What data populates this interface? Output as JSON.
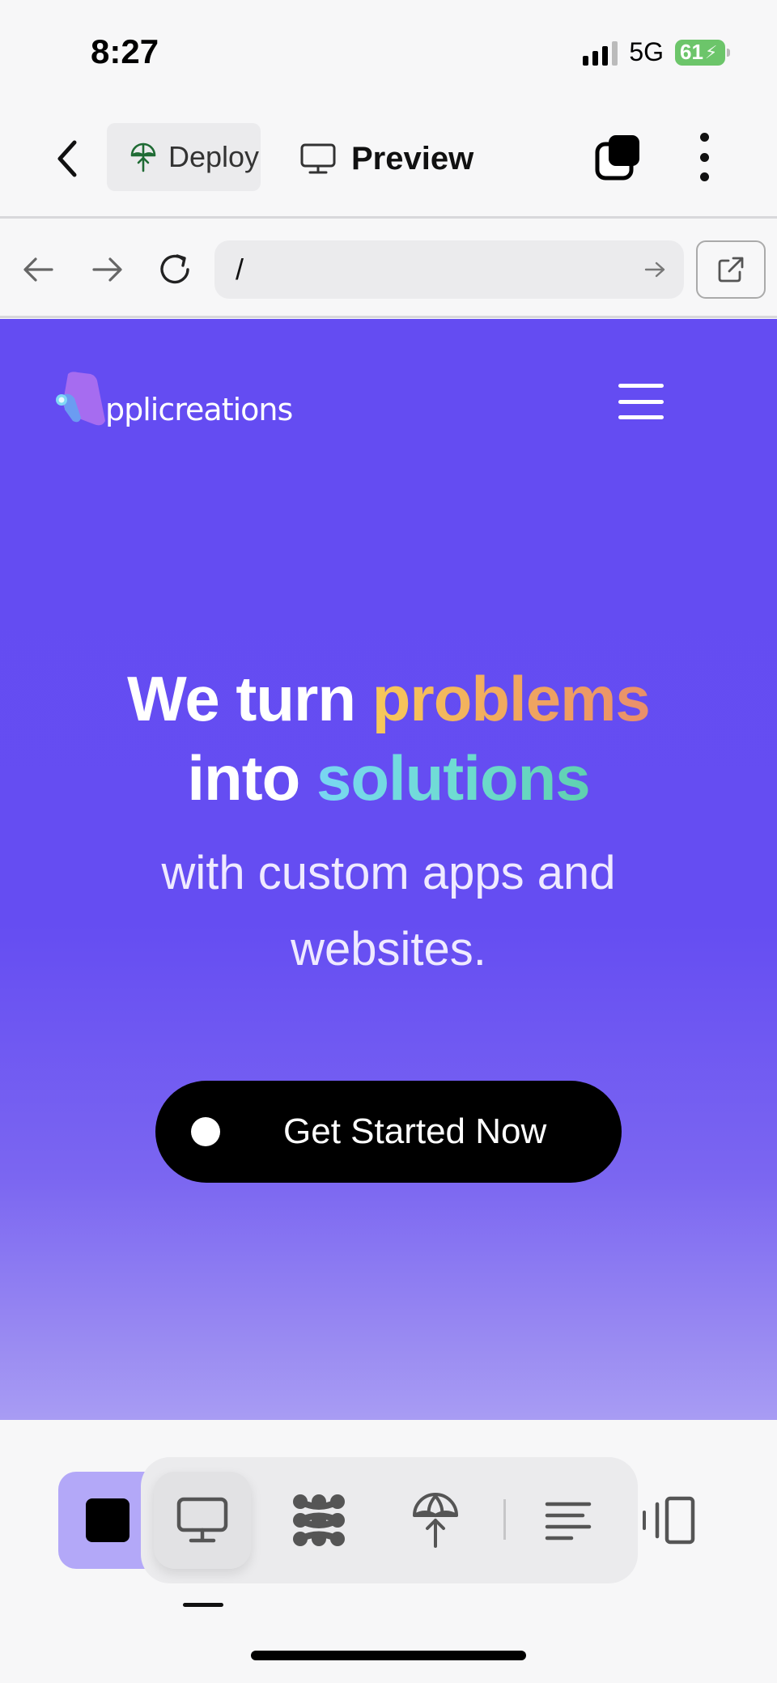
{
  "status_bar": {
    "time": "8:27",
    "network": "5G",
    "battery": "61",
    "battery_color": "#6cc56a"
  },
  "top_bar": {
    "deploy_label": "Deploy",
    "preview_label": "Preview",
    "icons": [
      "chevron-left-icon",
      "deploy-icon",
      "monitor-icon",
      "tabs-icon",
      "more-vertical-icon"
    ]
  },
  "address_bar": {
    "url": "/",
    "icons": [
      "arrow-left-icon",
      "arrow-right-icon",
      "reload-icon",
      "go-arrow-icon",
      "external-link-icon"
    ]
  },
  "site": {
    "logo_text": "pplicreations",
    "hero_line1_prefix": "We turn ",
    "hero_line1_highlight": "problems",
    "hero_line2_prefix": "into ",
    "hero_line2_highlight": "solutions",
    "hero_subtitle": "with custom apps and websites.",
    "cta_label": "Get Started Now",
    "colors": {
      "background": "#644cf2",
      "problems_gradient": [
        "#f7c95a",
        "#e98f6b"
      ],
      "solutions_gradient": [
        "#79d6f2",
        "#5fd0b0"
      ],
      "cta": "#000000"
    }
  },
  "bottom_toolbar": {
    "items": [
      "stop-icon",
      "monitor-icon",
      "workflow-icon",
      "deploy-icon",
      "console-icon",
      "side-panel-icon"
    ],
    "active": "monitor-icon",
    "accent": "#b3a8f8"
  }
}
